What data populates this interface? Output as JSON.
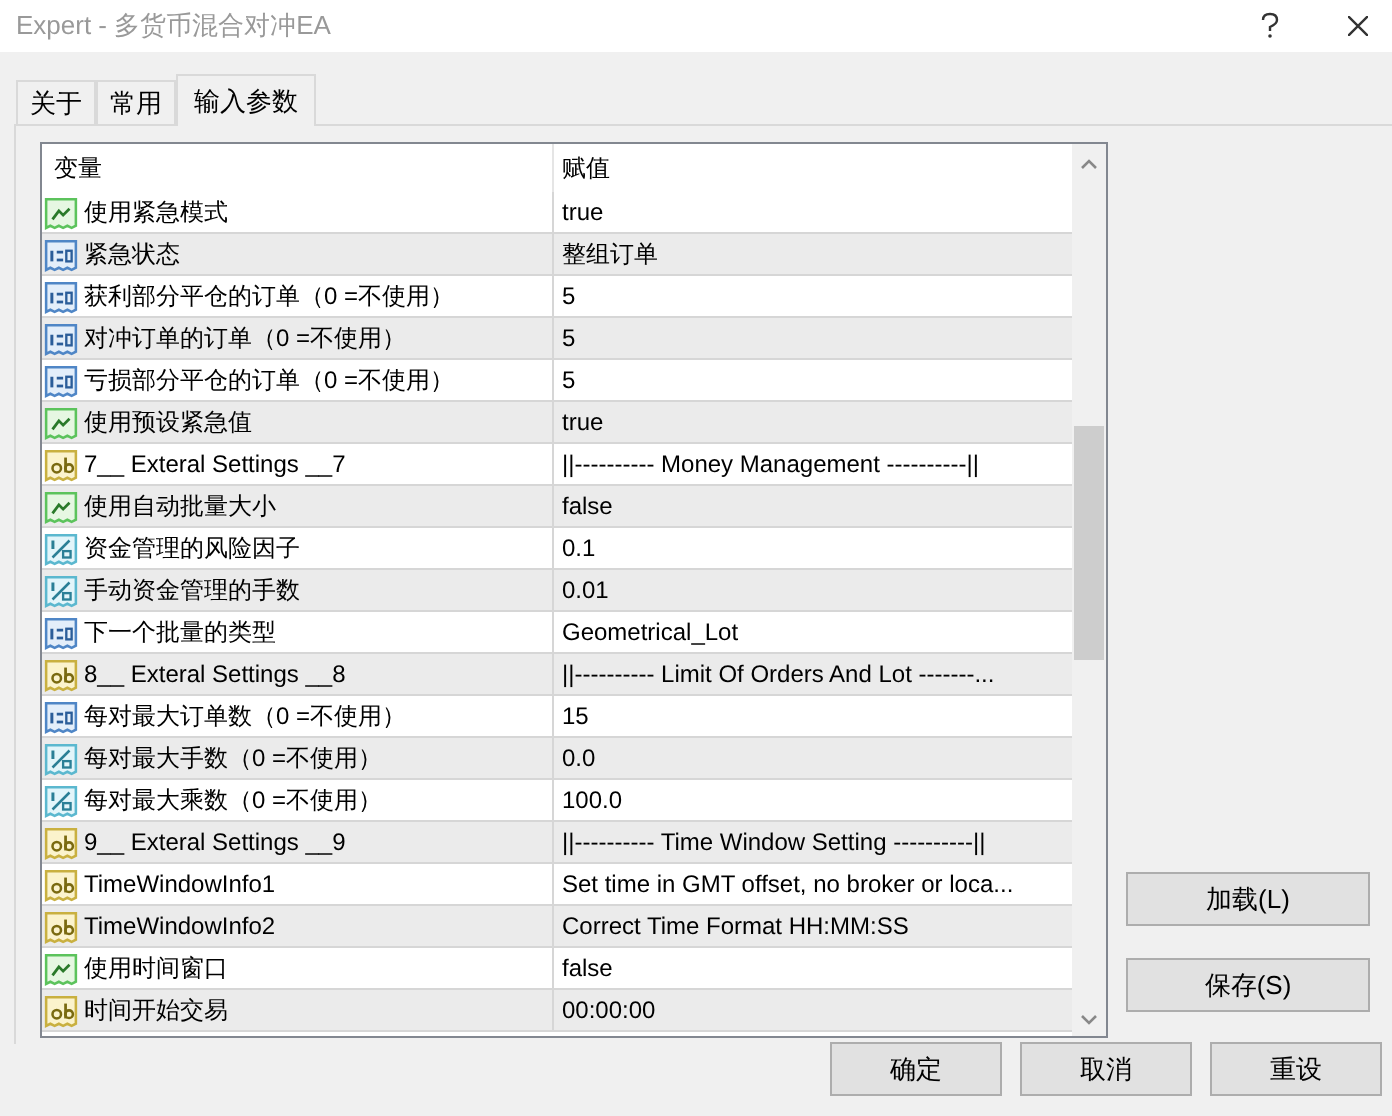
{
  "window": {
    "title": "Expert - 多货币混合对冲EA"
  },
  "tabs": [
    {
      "label": "关于",
      "selected": false
    },
    {
      "label": "常用",
      "selected": false
    },
    {
      "label": "输入参数",
      "selected": true
    }
  ],
  "table": {
    "columns": [
      "变量",
      "赋值"
    ],
    "rows": [
      {
        "kind": "bool",
        "name": "使用紧急模式",
        "value": "true"
      },
      {
        "kind": "int",
        "name": "紧急状态",
        "value": "整组订单"
      },
      {
        "kind": "int",
        "name": "获利部分平仓的订单（0 =不使用）",
        "value": "5"
      },
      {
        "kind": "int",
        "name": "对冲订单的订单（0 =不使用）",
        "value": "5"
      },
      {
        "kind": "int",
        "name": "亏损部分平仓的订单（0 =不使用）",
        "value": "5"
      },
      {
        "kind": "bool",
        "name": "使用预设紧急值",
        "value": "true"
      },
      {
        "kind": "string",
        "name": "7__ Exteral Settings __7",
        "value": "||---------- Money Management ----------||"
      },
      {
        "kind": "bool",
        "name": "使用自动批量大小",
        "value": "false"
      },
      {
        "kind": "double",
        "name": "资金管理的风险因子",
        "value": "0.1"
      },
      {
        "kind": "double",
        "name": "手动资金管理的手数",
        "value": "0.01"
      },
      {
        "kind": "int",
        "name": "下一个批量的类型",
        "value": "Geometrical_Lot"
      },
      {
        "kind": "string",
        "name": "8__ Exteral Settings __8",
        "value": "||---------- Limit Of Orders And Lot -------..."
      },
      {
        "kind": "int",
        "name": "每对最大订单数（0 =不使用）",
        "value": "15"
      },
      {
        "kind": "double",
        "name": "每对最大手数（0 =不使用）",
        "value": "0.0"
      },
      {
        "kind": "double",
        "name": "每对最大乘数（0 =不使用）",
        "value": "100.0"
      },
      {
        "kind": "string",
        "name": "9__ Exteral Settings __9",
        "value": "||---------- Time Window Setting ----------||"
      },
      {
        "kind": "string",
        "name": "TimeWindowInfo1",
        "value": "Set time in GMT offset, no broker or loca..."
      },
      {
        "kind": "string",
        "name": "TimeWindowInfo2",
        "value": "Correct Time Format HH:MM:SS"
      },
      {
        "kind": "bool",
        "name": "使用时间窗口",
        "value": "false"
      },
      {
        "kind": "string",
        "name": "时间开始交易",
        "value": "00:00:00"
      }
    ]
  },
  "side_buttons": [
    "加载(L)",
    "保存(S)"
  ],
  "buttons": [
    "确定",
    "取消",
    "重设"
  ]
}
